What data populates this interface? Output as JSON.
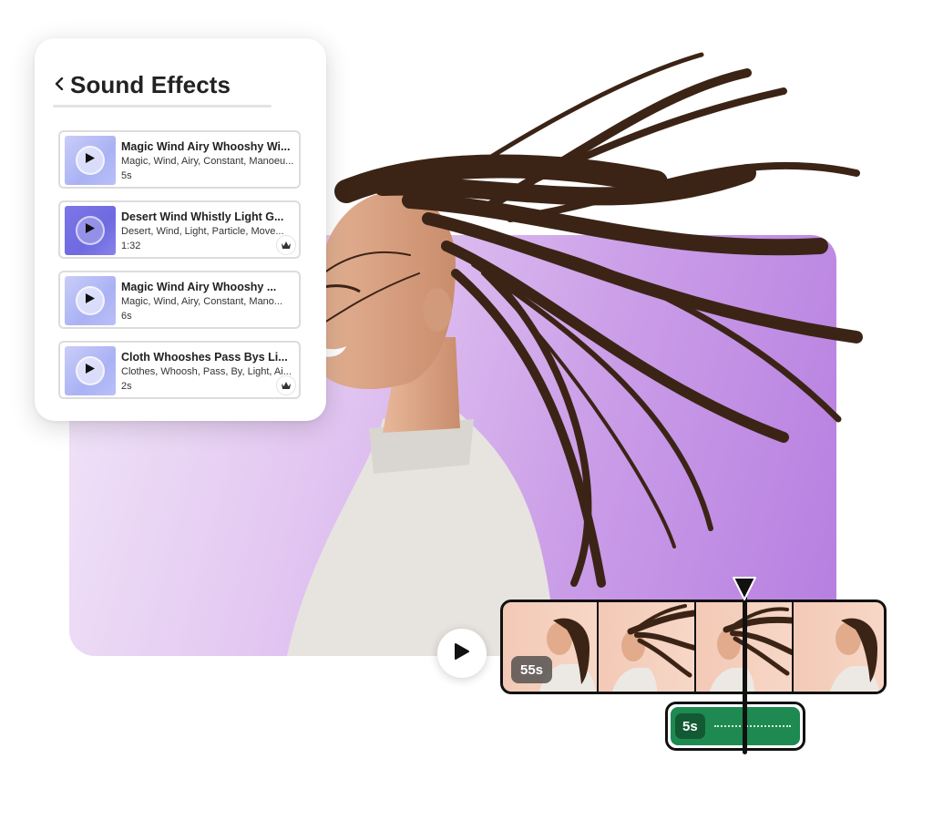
{
  "panel": {
    "title": "Sound Effects",
    "items": [
      {
        "title": "Magic Wind Airy Whooshy Wi...",
        "tags": "Magic, Wind, Airy, Constant, Manoeu...",
        "duration": "5s",
        "thumb_style": "light",
        "premium": false
      },
      {
        "title": "Desert Wind Whistly Light G...",
        "tags": "Desert, Wind, Light, Particle, Move...",
        "duration": "1:32",
        "thumb_style": "dark",
        "premium": true
      },
      {
        "title": "Magic Wind Airy Whooshy ...",
        "tags": "Magic, Wind, Airy, Constant, Mano...",
        "duration": "6s",
        "thumb_style": "light",
        "premium": false
      },
      {
        "title": "Cloth Whooshes Pass Bys Li...",
        "tags": "Clothes, Whoosh, Pass, By, Light, Ai...",
        "duration": "2s",
        "thumb_style": "light",
        "premium": true
      }
    ]
  },
  "video_timeline": {
    "duration_label": "55s",
    "frame_count": 4
  },
  "audio_clip": {
    "duration_label": "5s"
  },
  "colors": {
    "backdrop": "#cb9ee8",
    "audio_clip": "#1e8a51",
    "accent_dark": "#111111"
  },
  "icons": {
    "back": "chevron-left-icon",
    "play": "play-icon",
    "premium": "crown-icon",
    "playhead": "playhead-marker-icon"
  }
}
